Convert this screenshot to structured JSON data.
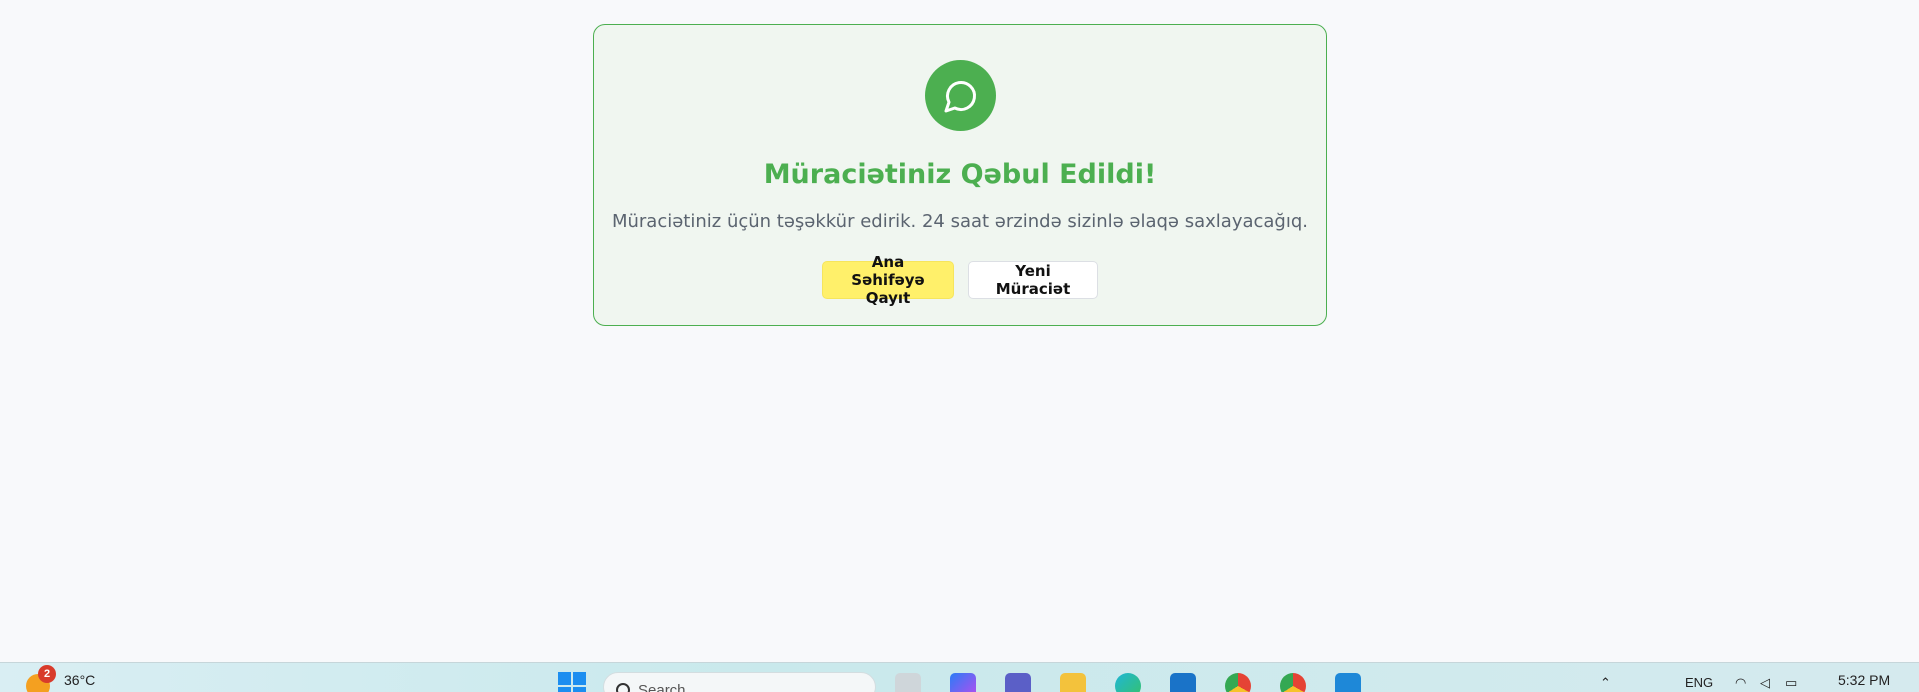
{
  "card": {
    "title": "Müraciətiniz Qəbul Edildi!",
    "subtitle": "Müraciətiniz üçün təşəkkür edirik. 24 saat ərzində sizinlə əlaqə saxlayacağıq.",
    "primary_button": "Ana Səhifəyə Qayıt",
    "secondary_button": "Yeni Müraciət",
    "icon": "message-circle-icon",
    "accent_color": "#4caf50",
    "primary_color": "#fff06a"
  },
  "taskbar": {
    "weather_badge": "2",
    "temperature": "36°C",
    "search_placeholder": "Search",
    "language": "ENG",
    "time": "5:32 PM",
    "apps": [
      "task-view-icon",
      "copilot-icon",
      "teams-icon",
      "file-explorer-icon",
      "edge-icon",
      "store-icon",
      "chrome-icon",
      "chrome-profile-icon",
      "vscode-icon"
    ]
  }
}
